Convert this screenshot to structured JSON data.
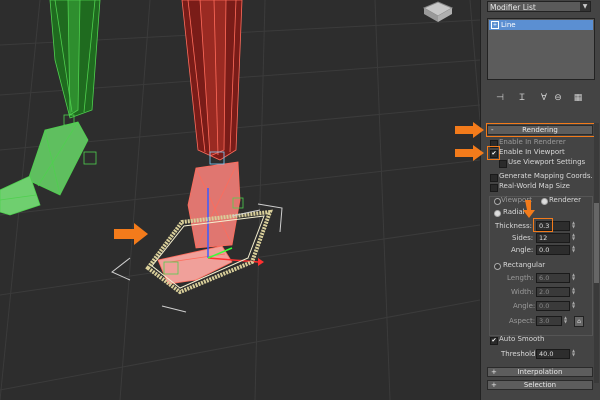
{
  "modifier_panel": {
    "modifier_list": "Modifier List",
    "stack_item": "Line",
    "toolbar_icons": [
      "pin-stack-icon",
      "show-end-result-icon",
      "make-unique-icon",
      "remove-modifier-icon",
      "configure-sets-icon"
    ]
  },
  "rendering": {
    "title": "Rendering",
    "enable_in_renderer": "Enable In Renderer",
    "enable_in_viewport": "Enable In Viewport",
    "use_viewport_settings": "Use Viewport Settings",
    "generate_mapping": "Generate Mapping Coords.",
    "real_world_map": "Real-World Map Size",
    "viewport": "Viewport",
    "renderer": "Renderer",
    "radial": "Radial",
    "thickness_label": "Thickness:",
    "thickness": "0.3",
    "sides_label": "Sides:",
    "sides": "12",
    "angle_label": "Angle:",
    "angle": "0.0",
    "rectangular": "Rectangular",
    "length_label": "Length:",
    "length": "6.0",
    "width_label": "Width:",
    "width": "2.0",
    "rect_angle_label": "Angle:",
    "rect_angle": "0.0",
    "aspect_label": "Aspect:",
    "aspect": "3.0",
    "auto_smooth": "Auto Smooth",
    "threshold_label": "Threshold:",
    "threshold": "40.0"
  },
  "rollouts": {
    "interpolation": "Interpolation",
    "selection": "Selection"
  },
  "colors": {
    "highlight": "#f37b1b",
    "selection_blue": "#5b8fd2"
  }
}
